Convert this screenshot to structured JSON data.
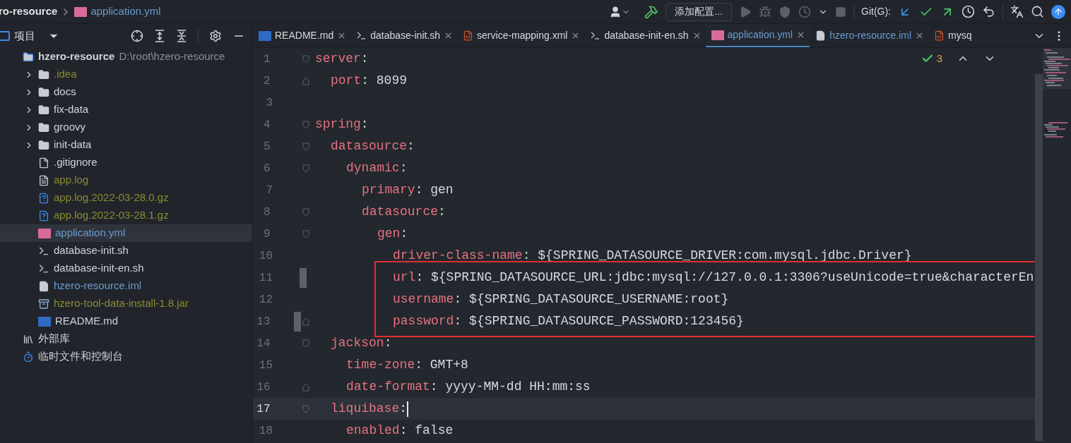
{
  "breadcrumb": {
    "project": "ro-resource",
    "file": "application.yml"
  },
  "toolbar": {
    "config_button": "添加配置...",
    "git_label": "Git(G):"
  },
  "project_panel": {
    "title": "项目",
    "tree": [
      {
        "label": "hzero-resource",
        "path": "D:\\root\\hzero-resource",
        "kind": "module",
        "selected": false,
        "children": [
          {
            "label": ".idea",
            "kind": "folder",
            "color": "#8c8c2e",
            "selected": false,
            "expanded": false
          },
          {
            "label": "docs",
            "kind": "folder",
            "color": "#cfd3da",
            "selected": false,
            "expanded": false
          },
          {
            "label": "fix-data",
            "kind": "folder",
            "color": "#cfd3da",
            "selected": false,
            "expanded": false
          },
          {
            "label": "groovy",
            "kind": "folder",
            "color": "#cfd3da",
            "selected": false,
            "expanded": false
          },
          {
            "label": "init-data",
            "kind": "folder",
            "color": "#cfd3da",
            "selected": false,
            "expanded": false
          },
          {
            "label": ".gitignore",
            "kind": "ignore",
            "color": "#cfd3da",
            "selected": false
          },
          {
            "label": "app.log",
            "kind": "text",
            "color": "#8c8c2e",
            "selected": false
          },
          {
            "label": "app.log.2022-03-28.0.gz",
            "kind": "unknown",
            "color": "#8c8c2e",
            "selected": false
          },
          {
            "label": "app.log.2022-03-28.1.gz",
            "kind": "unknown",
            "color": "#8c8c2e",
            "selected": false
          },
          {
            "label": "application.yml",
            "kind": "yml",
            "color": "#6b9bd2",
            "selected": true
          },
          {
            "label": "database-init.sh",
            "kind": "shell",
            "color": "#cfd3da",
            "selected": false
          },
          {
            "label": "database-init-en.sh",
            "kind": "shell",
            "color": "#cfd3da",
            "selected": false
          },
          {
            "label": "hzero-resource.iml",
            "kind": "module-file",
            "color": "#6b9bd2",
            "selected": false
          },
          {
            "label": "hzero-tool-data-install-1.8.jar",
            "kind": "jar",
            "color": "#8c8c2e",
            "selected": false
          },
          {
            "label": "README.md",
            "kind": "md",
            "color": "#cfd3da",
            "selected": false
          }
        ]
      },
      {
        "label": "外部库",
        "kind": "libraries",
        "selected": false
      },
      {
        "label": "临时文件和控制台",
        "kind": "scratches",
        "selected": false
      }
    ]
  },
  "tabs": [
    {
      "label": "README.md",
      "kind": "md",
      "selected": false
    },
    {
      "label": "database-init.sh",
      "kind": "shell",
      "selected": false
    },
    {
      "label": "service-mapping.xml",
      "kind": "xml",
      "selected": false
    },
    {
      "label": "database-init-en.sh",
      "kind": "shell",
      "selected": false
    },
    {
      "label": "application.yml",
      "kind": "yml",
      "selected": true
    },
    {
      "label": "hzero-resource.iml",
      "kind": "module-file",
      "selected": false
    },
    {
      "label": "mysq",
      "kind": "xml",
      "selected": false
    }
  ],
  "inspections": {
    "count": "3"
  },
  "editor": {
    "lines": [
      {
        "number": "1",
        "text": "server:",
        "kind": "opener",
        "changed": false,
        "boxed": false,
        "current": false,
        "children": [
          {
            "number": "2",
            "text": "port: 8099",
            "kind": "closer",
            "changed": false,
            "boxed": false,
            "current": false
          }
        ]
      },
      {
        "number": "3",
        "kind": "plain",
        "changed": false,
        "boxed": false,
        "current": false
      },
      {
        "number": "4",
        "text": "spring:",
        "kind": "opener",
        "changed": false,
        "boxed": false,
        "current": false,
        "children": [
          {
            "number": "5",
            "text": "datasource:",
            "kind": "opener",
            "changed": false,
            "boxed": false,
            "current": false,
            "children": [
              {
                "number": "6",
                "text": "dynamic:",
                "kind": "opener",
                "changed": false,
                "boxed": false,
                "current": false,
                "children": [
                  {
                    "number": "7",
                    "text": "primary: gen",
                    "kind": "plain",
                    "changed": false,
                    "boxed": false,
                    "current": false
                  },
                  {
                    "number": "8",
                    "text": "datasource:",
                    "kind": "opener",
                    "changed": false,
                    "boxed": false,
                    "current": false,
                    "children": [
                      {
                        "number": "9",
                        "text": "gen:",
                        "kind": "opener",
                        "changed": false,
                        "boxed": false,
                        "current": false,
                        "children": [
                          {
                            "number": "10",
                            "text": "driver-class-name: ${SPRING_DATASOURCE_DRIVER:com.mysql.jdbc.Driver}",
                            "kind": "plain",
                            "changed": false,
                            "boxed": false,
                            "current": false
                          },
                          {
                            "number": "11",
                            "text": "url: ${SPRING_DATASOURCE_URL:jdbc:mysql://127.0.0.1:3306?useUnicode=true&characterEn",
                            "kind": "plain",
                            "changed": true,
                            "boxed": true,
                            "current": false
                          },
                          {
                            "number": "12",
                            "text": "username: ${SPRING_DATASOURCE_USERNAME:root}",
                            "kind": "plain",
                            "changed": false,
                            "boxed": true,
                            "current": false
                          },
                          {
                            "number": "13",
                            "text": "password: ${SPRING_DATASOURCE_PASSWORD:123456}",
                            "kind": "closer",
                            "changed": true,
                            "boxed": true,
                            "current": false
                          }
                        ]
                      }
                    ]
                  }
                ]
              }
            ]
          },
          {
            "number": "14",
            "text": "jackson:",
            "kind": "opener",
            "changed": false,
            "boxed": false,
            "current": false,
            "children": [
              {
                "number": "15",
                "text": "time-zone: GMT+8",
                "kind": "plain",
                "changed": false,
                "boxed": false,
                "current": false
              },
              {
                "number": "16",
                "text": "date-format: yyyy-MM-dd HH:mm:ss",
                "kind": "closer",
                "changed": false,
                "boxed": false,
                "current": false
              }
            ]
          },
          {
            "number": "17",
            "text": "liquibase:",
            "kind": "opener",
            "changed": false,
            "boxed": false,
            "current": true,
            "children": [
              {
                "number": "18",
                "text": "enabled: false",
                "kind": "plain",
                "changed": false,
                "boxed": false,
                "current": false
              }
            ]
          }
        ]
      }
    ]
  }
}
